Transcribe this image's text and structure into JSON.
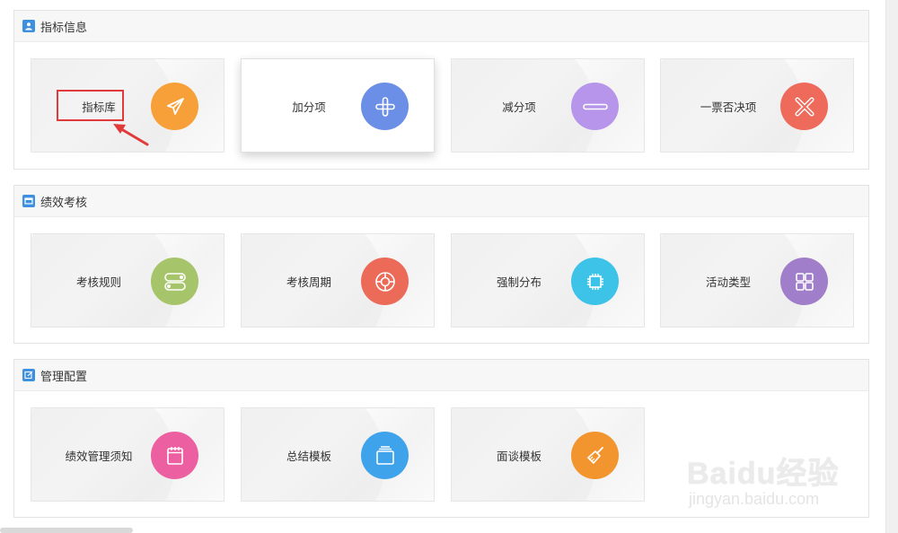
{
  "sections": [
    {
      "title": "指标信息",
      "icon": "user-card-icon",
      "cards": [
        {
          "label": "指标库",
          "icon": "paper-plane-icon",
          "color": "#f7a03a"
        },
        {
          "label": "加分项",
          "icon": "plus-icon",
          "color": "#6b8fe6"
        },
        {
          "label": "减分项",
          "icon": "minus-icon",
          "color": "#b795ea"
        },
        {
          "label": "一票否决项",
          "icon": "close-x-icon",
          "color": "#ee6a5a"
        }
      ]
    },
    {
      "title": "绩效考核",
      "icon": "window-icon",
      "cards": [
        {
          "label": "考核规则",
          "icon": "toggle-icon",
          "color": "#a6c46a"
        },
        {
          "label": "考核周期",
          "icon": "lifebuoy-icon",
          "color": "#ec6a58"
        },
        {
          "label": "强制分布",
          "icon": "chip-icon",
          "color": "#3ec3e8"
        },
        {
          "label": "活动类型",
          "icon": "grid-icon",
          "color": "#a07ec9"
        }
      ]
    },
    {
      "title": "管理配置",
      "icon": "edit-icon",
      "cards": [
        {
          "label": "绩效管理须知",
          "icon": "calendar-icon",
          "color": "#ec5fa0"
        },
        {
          "label": "总结模板",
          "icon": "folder-icon",
          "color": "#3fa3ec"
        },
        {
          "label": "面谈模板",
          "icon": "broom-icon",
          "color": "#f3952f"
        }
      ]
    }
  ],
  "watermark": {
    "brand": "Baidu经验",
    "url": "jingyan.baidu.com"
  }
}
